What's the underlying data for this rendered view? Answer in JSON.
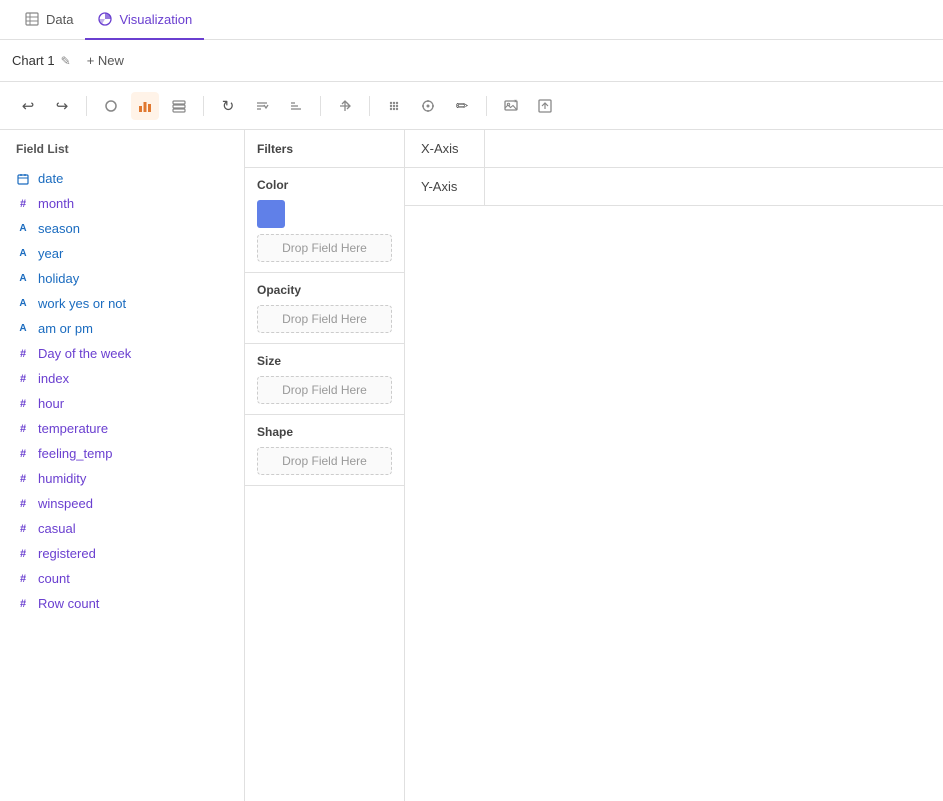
{
  "topNav": {
    "tabs": [
      {
        "id": "data",
        "label": "Data",
        "icon": "table-icon",
        "active": false
      },
      {
        "id": "visualization",
        "label": "Visualization",
        "icon": "chart-icon",
        "active": true
      }
    ]
  },
  "chartBar": {
    "chartLabel": "Chart 1",
    "editIcon": "✎",
    "newBtnLabel": "+ New"
  },
  "toolbar": {
    "buttons": [
      {
        "id": "undo",
        "icon": "↩",
        "label": "Undo",
        "active": false
      },
      {
        "id": "redo",
        "icon": "↪",
        "label": "Redo",
        "active": false
      },
      {
        "id": "mark-circle",
        "icon": "⬤",
        "label": "Mark Circle",
        "active": false
      },
      {
        "id": "mark-bar",
        "icon": "▬",
        "label": "Mark Bar",
        "active": true
      },
      {
        "id": "mark-layers",
        "icon": "◫",
        "label": "Mark Layers",
        "active": false
      },
      {
        "id": "refresh",
        "icon": "↻",
        "label": "Refresh",
        "active": false
      },
      {
        "id": "sort-asc",
        "icon": "⇅",
        "label": "Sort Ascending",
        "active": false
      },
      {
        "id": "sort-desc",
        "icon": "⇵",
        "label": "Sort Descending",
        "active": false
      },
      {
        "id": "swap-axes",
        "icon": "⇔",
        "label": "Swap Axes",
        "active": false
      },
      {
        "id": "grid",
        "icon": "⊞",
        "label": "Grid",
        "active": false
      },
      {
        "id": "pointer",
        "icon": "⊕",
        "label": "Pointer",
        "active": false
      },
      {
        "id": "pen",
        "icon": "✏",
        "label": "Pen",
        "active": false
      },
      {
        "id": "image",
        "icon": "▣",
        "label": "Image Settings",
        "active": false
      },
      {
        "id": "export",
        "icon": "⊡",
        "label": "Export",
        "active": false
      }
    ]
  },
  "fieldList": {
    "title": "Field List",
    "fields": [
      {
        "id": "date",
        "name": "date",
        "type": "date",
        "colorClass": "date-icon",
        "symbol": "□"
      },
      {
        "id": "month",
        "name": "month",
        "type": "string",
        "colorClass": "hash",
        "symbol": "#"
      },
      {
        "id": "season",
        "name": "season",
        "type": "string",
        "colorClass": "abc",
        "symbol": "A"
      },
      {
        "id": "year",
        "name": "year",
        "type": "string",
        "colorClass": "abc",
        "symbol": "A"
      },
      {
        "id": "holiday",
        "name": "holiday",
        "type": "string",
        "colorClass": "abc",
        "symbol": "A"
      },
      {
        "id": "work-yes-no",
        "name": "work yes or not",
        "type": "string",
        "colorClass": "abc",
        "symbol": "A"
      },
      {
        "id": "am-or-pm",
        "name": "am or pm",
        "type": "string",
        "colorClass": "abc",
        "symbol": "A"
      },
      {
        "id": "day-of-week",
        "name": "Day of the week",
        "type": "string",
        "colorClass": "hash",
        "symbol": "#"
      },
      {
        "id": "index",
        "name": "index",
        "type": "numeric",
        "colorClass": "hash",
        "symbol": "#"
      },
      {
        "id": "hour",
        "name": "hour",
        "type": "numeric",
        "colorClass": "hash",
        "symbol": "#"
      },
      {
        "id": "temperature",
        "name": "temperature",
        "type": "numeric",
        "colorClass": "hash",
        "symbol": "#"
      },
      {
        "id": "feeling-temp",
        "name": "feeling_temp",
        "type": "numeric",
        "colorClass": "hash",
        "symbol": "#"
      },
      {
        "id": "humidity",
        "name": "humidity",
        "type": "numeric",
        "colorClass": "hash",
        "symbol": "#"
      },
      {
        "id": "winspeed",
        "name": "winspeed",
        "type": "numeric",
        "colorClass": "hash",
        "symbol": "#"
      },
      {
        "id": "casual",
        "name": "casual",
        "type": "numeric",
        "colorClass": "hash",
        "symbol": "#"
      },
      {
        "id": "registered",
        "name": "registered",
        "type": "numeric",
        "colorClass": "hash",
        "symbol": "#"
      },
      {
        "id": "count",
        "name": "count",
        "type": "numeric",
        "colorClass": "hash",
        "symbol": "#"
      },
      {
        "id": "row-count",
        "name": "Row count",
        "type": "numeric",
        "colorClass": "hash",
        "symbol": "#"
      }
    ]
  },
  "middlePanel": {
    "filtersLabel": "Filters",
    "colorLabel": "Color",
    "colorSwatchHex": "#6080e8",
    "colorDropLabel": "Drop Field Here",
    "opacityLabel": "Opacity",
    "opacityDropLabel": "Drop Field Here",
    "sizeLabel": "Size",
    "sizeDropLabel": "Drop Field Here",
    "shapeLabel": "Shape",
    "shapeDropLabel": "Drop Field Here"
  },
  "axesPanel": {
    "xAxisLabel": "X-Axis",
    "yAxisLabel": "Y-Axis"
  }
}
